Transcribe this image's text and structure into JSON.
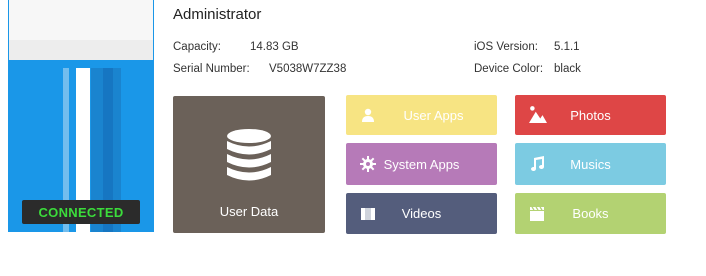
{
  "device": {
    "name": "Administrator",
    "status": "CONNECTED",
    "capacity_label": "Capacity:",
    "capacity_value": "14.83 GB",
    "serial_label": "Serial Number:",
    "serial_value": "V5038W7ZZ38",
    "ios_label": "iOS Version:",
    "ios_value": "5.1.1",
    "color_label": "Device Color:",
    "color_value": "black"
  },
  "tiles": {
    "user_data": "User Data",
    "user_apps": "User Apps",
    "system_apps": "System Apps",
    "videos": "Videos",
    "photos": "Photos",
    "musics": "Musics",
    "books": "Books"
  },
  "colors": {
    "device_bg": "#1a97e8",
    "user_data": "#6b6159",
    "user_apps": "#f7e483",
    "system_apps": "#b67ab8",
    "videos": "#545d7c",
    "photos": "#de4646",
    "musics": "#7ccbe2",
    "books": "#b3d272",
    "connected_text": "#3bdc3b"
  },
  "icons": {
    "user_data": "database-icon",
    "user_apps": "user-icon",
    "system_apps": "gear-icon",
    "videos": "film-icon",
    "photos": "mountain-photo-icon",
    "musics": "music-note-icon",
    "books": "clapper-book-icon"
  }
}
